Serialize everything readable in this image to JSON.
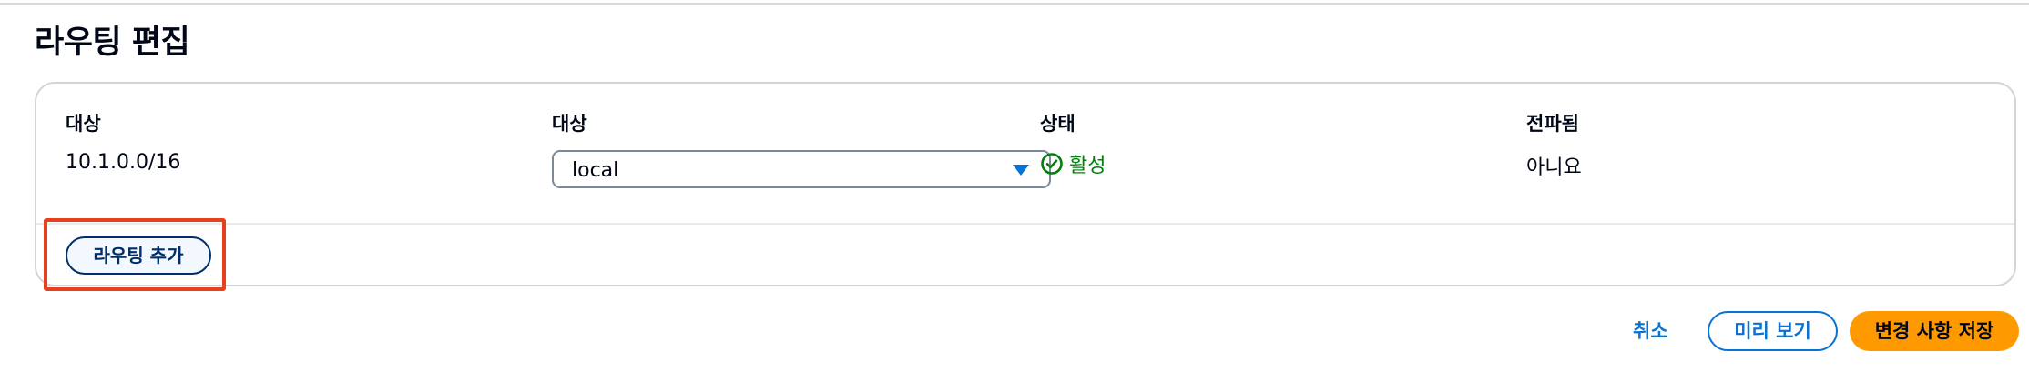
{
  "page": {
    "title": "라우팅 편집"
  },
  "table": {
    "headers": [
      "대상",
      "대상",
      "상태",
      "전파됨"
    ],
    "row": {
      "destination": "10.1.0.0/16",
      "target_value": "local",
      "status": "활성",
      "propagated": "아니요"
    }
  },
  "actions": {
    "add_route": "라우팅 추가",
    "cancel": "취소",
    "preview": "미리 보기",
    "save": "변경 사항 저장"
  },
  "icons": {
    "status": "check-circle-icon",
    "select": "caret-down-icon"
  },
  "colors": {
    "link_blue": "#0972d3",
    "success_green": "#037f0c",
    "primary_orange": "#ff9900",
    "highlight_red": "#e8401e"
  }
}
